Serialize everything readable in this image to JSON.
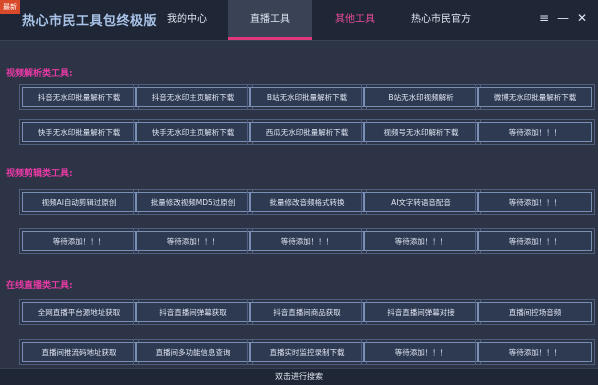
{
  "window": {
    "badge": "最新",
    "title": "热心市民工具包终极版",
    "tabs": [
      "我的中心",
      "直播工具",
      "其他工具",
      "热心市民官方"
    ],
    "menu_icon": "hamburger-icon",
    "min_icon": "minimize-icon",
    "close_icon": "close-icon"
  },
  "sections": [
    {
      "title": "视频解析类工具:",
      "rows": [
        [
          "抖音无水印批量解析下载",
          "抖音无水印主页解析下载",
          "B站无水印批量解析下载",
          "B站无水印视频解析",
          "微博无水印批量解析下载"
        ],
        [
          "快手无水印批量解析下载",
          "快手无水印主页解析下载",
          "西瓜无水印批量解析下载",
          "视频号无水印解析下载",
          "等待添加！！！"
        ]
      ]
    },
    {
      "title": "视频剪辑类工具:",
      "rows": [
        [
          "视频AI自动剪辑过原创",
          "批量修改视频MD5过原创",
          "批量修改音频格式转换",
          "AI文字转语音配音",
          "等待添加！！！"
        ],
        [
          "等待添加！！！",
          "等待添加！！！",
          "等待添加！！！",
          "等待添加！！！",
          "等待添加！！！"
        ]
      ]
    },
    {
      "title": "在线直播类工具:",
      "rows": [
        [
          "全网直播平台源地址获取",
          "抖音直播间弹幕获取",
          "抖音直播间商品获取",
          "抖音直播间弹幕对接",
          "直播间控场音频"
        ],
        [
          "直播间推流码地址获取",
          "直播间多功能信息查询",
          "直播实时监控录制下载",
          "等待添加！！！",
          "等待添加！！！"
        ]
      ]
    }
  ],
  "footer": {
    "label": "双击进行搜索"
  }
}
